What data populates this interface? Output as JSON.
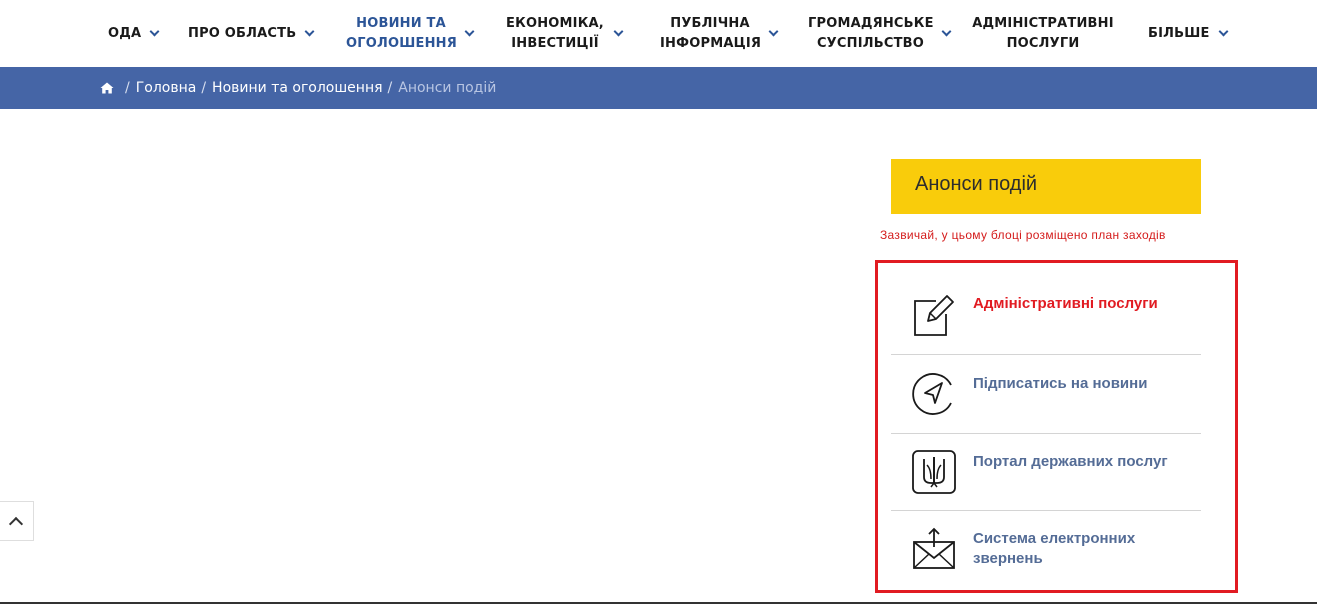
{
  "nav": {
    "items": [
      {
        "label": "ОДА",
        "active": false
      },
      {
        "label": "ПРО ОБЛАСТЬ",
        "active": false
      },
      {
        "label": "НОВИНИ ТА ОГОЛОШЕННЯ",
        "active": true
      },
      {
        "label": "ЕКОНОМІКА, ІНВЕСТИЦІЇ",
        "active": false
      },
      {
        "label": "ПУБЛІЧНА ІНФОРМАЦІЯ",
        "active": false
      },
      {
        "label": "ГРОМАДЯНСЬКЕ СУСПІЛЬСТВО",
        "active": false
      },
      {
        "label": "АДМІНІСТРАТИВНІ ПОСЛУГИ",
        "active": false
      },
      {
        "label": "БІЛЬШЕ",
        "active": false
      }
    ]
  },
  "breadcrumb": {
    "home": "Головна",
    "section": "Новини та оголошення",
    "current": "Анонси подій"
  },
  "sidebar": {
    "banner_title": "Анонси подій",
    "note": "Зазвичай, у цьому блоці розміщено план заходів",
    "links": [
      {
        "label": "Адміністративні послуги",
        "icon": "edit-document-icon",
        "highlighted": true
      },
      {
        "label": "Підписатись на новини",
        "icon": "navigation-arrow-icon",
        "highlighted": false
      },
      {
        "label": "Портал державних послуг",
        "icon": "trident-coat-of-arms-icon",
        "highlighted": false
      },
      {
        "label": "Система електронних звернень",
        "icon": "envelope-upload-icon",
        "highlighted": false
      }
    ]
  },
  "colors": {
    "breadcrumb_bar": "#4565a6",
    "banner": "#f9cc0b",
    "highlight_red": "#e11b22",
    "link_blue": "#546c96",
    "nav_active": "#2c5597"
  }
}
